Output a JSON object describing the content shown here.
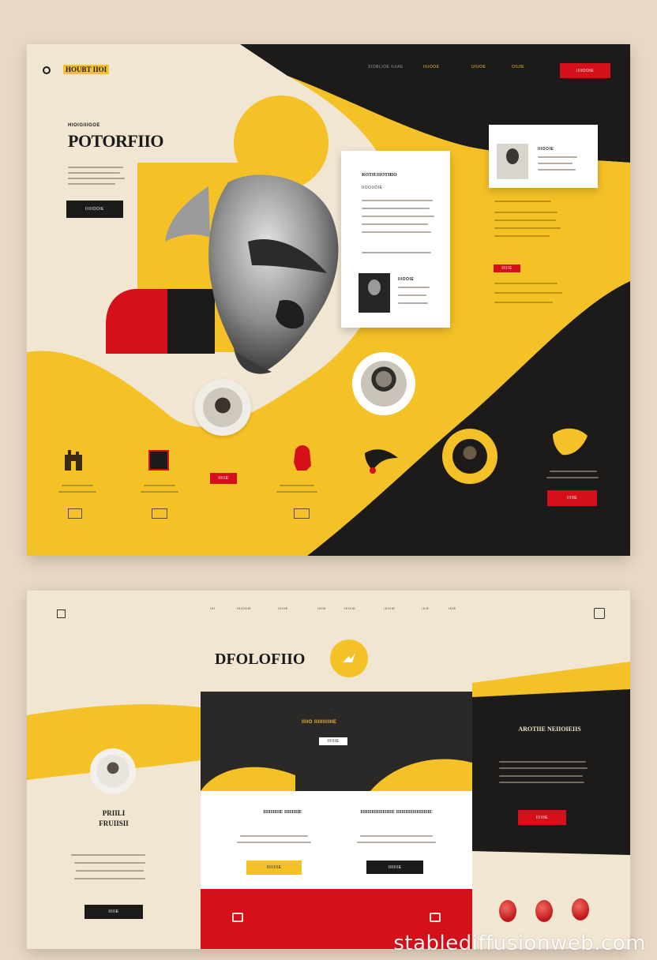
{
  "colors": {
    "background": "#e8d9c4",
    "cream": "#f1e6d2",
    "yellow": "#f4c126",
    "black": "#1c1b1a",
    "red": "#d5101b",
    "white": "#ffffff"
  },
  "top_card": {
    "brand": "HOUBT IIOI",
    "nav": [
      "SIOBLIOE IUIAE",
      "IIUOOE",
      "UIUOE",
      "OIUIE"
    ],
    "nav_button": "IIIIOOIE",
    "hero": {
      "eyebrow": "HIOIGIIIGOE",
      "title": "POTORFIIO",
      "cta": "IIIIIOOIE"
    },
    "article_card": {
      "title": "ROTIUIIOTIIIO",
      "subtitle": "IIOOIIOIE",
      "caption": "IIIOOIE"
    },
    "profile_card": {
      "name": "IIIOOIE"
    },
    "side_tag": "IIIIIE",
    "right_button": "IIIIIE",
    "feature_tag": "IIIIIE",
    "icons": [
      "building-icon",
      "frame-icon",
      "horse-icon",
      "bird-icon",
      "leaf-icon"
    ]
  },
  "bottom_card": {
    "nav": [
      "IIII",
      "IIIIOOIE",
      "IIIIIIE",
      "IIIIIE",
      "IIIIIIIE",
      "IIIIIIIE",
      "IIIIE",
      "IIIIE"
    ],
    "title": "DFOLOFIIO",
    "dark_panel": {
      "heading": "IIIIO IIIIIIIIIIIE",
      "button": "IIIIIIE"
    },
    "right_panel": {
      "heading": "AROTIIE NEIIOIEIIS",
      "button": "IIIIIIE"
    },
    "left_profile": {
      "title": "PRIILI FRUIISII"
    },
    "white_panel": {
      "left_heading": "IIIIIIIIIE IIIIIIIIE",
      "right_heading": "IIIIIIIIIIIIIIIIIE IIIIIIIIIIIIIIIIIIE",
      "left_button": "IIIIIIIIE",
      "right_button": "IIIIIIIE"
    },
    "dark_button": "IIIIIE"
  },
  "watermark": "stablediffusionweb.com"
}
